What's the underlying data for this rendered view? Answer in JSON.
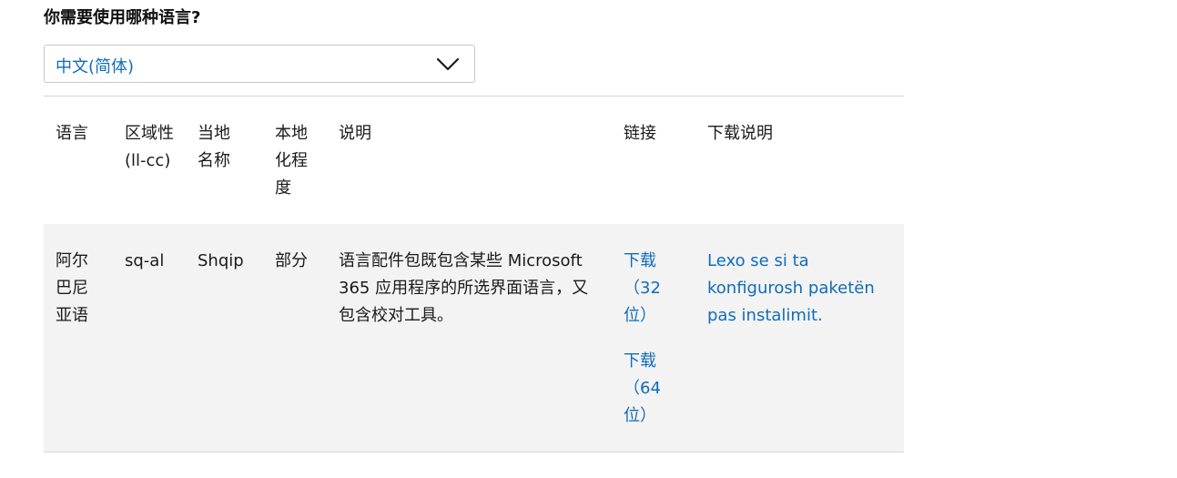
{
  "question": "你需要使用哪种语言?",
  "language_select": {
    "value": "中文(简体)"
  },
  "table": {
    "headers": {
      "language": "语言",
      "locale": "区域性 (ll-cc)",
      "native_name": "当地名称",
      "localization": "本地化程度",
      "description": "说明",
      "links": "链接",
      "instructions": "下载说明"
    },
    "rows": [
      {
        "language": "阿尔巴尼亚语",
        "locale": "sq-al",
        "native_name": "Shqip",
        "localization": "部分",
        "description": "语言配件包既包含某些 Microsoft 365 应用程序的所选界面语言，又包含校对工具。",
        "download_32": "下载（32位）",
        "download_64": "下载（64位）",
        "instructions_link": "Lexo se si ta konfigurosh paketën pas instalimit."
      }
    ]
  },
  "colors": {
    "link": "#0f6cbd",
    "row_background": "#f3f3f3",
    "rule": "#d6d6d6"
  },
  "icons": {
    "select_arrow": "chevron-down-icon"
  }
}
